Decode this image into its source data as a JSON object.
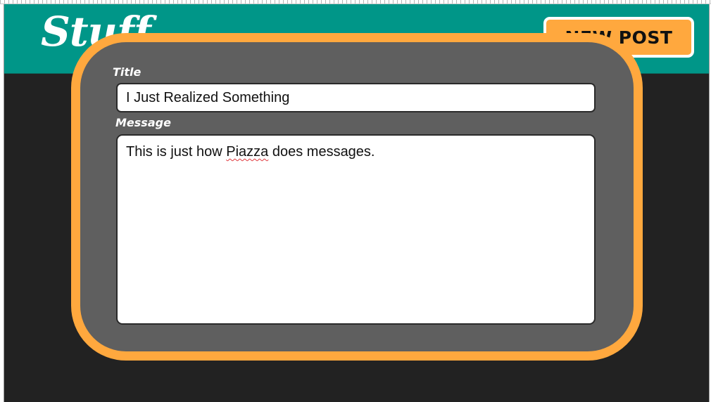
{
  "app": {
    "logo_text": "Stuff",
    "new_post_label": "NEW POST"
  },
  "modal": {
    "title_label": "Title",
    "title_value": "I Just Realized Something",
    "message_label": "Message",
    "message_parts": {
      "before": "This is just how ",
      "misspelled": "Piazza",
      "after": " does messages."
    }
  },
  "colors": {
    "header": "#009688",
    "accent": "#ffa83e",
    "modal_bg": "#5f5f5f",
    "page_bg": "#222222"
  }
}
